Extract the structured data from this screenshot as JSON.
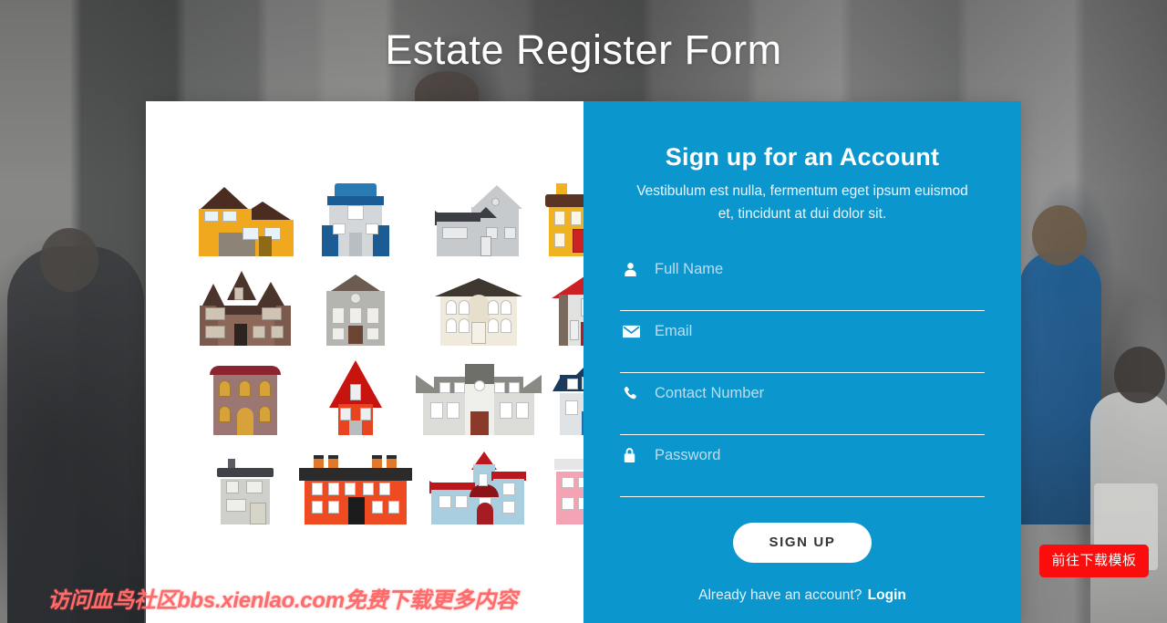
{
  "page": {
    "title": "Estate Register Form",
    "accent_blue": "#0b96ce",
    "card_bg": "#ffffff"
  },
  "illustration": {
    "alt": "grid of sixteen flat-style house illustrations",
    "rows": [
      [
        {
          "name": "yellow-victorian-house",
          "wall": "#f0a91e",
          "roof": "#4a2c20",
          "door": "#f0a91e"
        },
        {
          "name": "blue-roof-townhouse",
          "wall": "#d3d7da",
          "roof": "#1a5c93",
          "door": "#b9bec2"
        },
        {
          "name": "grey-gable-house",
          "wall": "#c7cacc",
          "roof": "#3b3f44",
          "door": "#e8eaec"
        },
        {
          "name": "yellow-shopfront-house",
          "wall": "#f0b21e",
          "roof": "#5a3526",
          "door": "#cc2222"
        }
      ],
      [
        {
          "name": "brown-manor-house",
          "wall": "#7b5a4d",
          "roof": "#4a342c",
          "door": "#2c2420"
        },
        {
          "name": "grey-gambrel-barn-house",
          "wall": "#b4b4b0",
          "roof": "#6b5b50",
          "door": "#6b4434"
        },
        {
          "name": "cream-colonial-house",
          "wall": "#efeadc",
          "roof": "#3e3830",
          "door": "#f4f1e8"
        },
        {
          "name": "red-roof-chalet",
          "wall": "#e2e2e0",
          "roof": "#cc1f26",
          "door": "#b31c22"
        }
      ],
      [
        {
          "name": "mauve-terrace-house",
          "wall": "#9b7672",
          "roof": "#8b2430",
          "door": "#d8a23a"
        },
        {
          "name": "red-a-frame-house",
          "wall": "#e8441f",
          "roof": "#c7140f",
          "door": "#b8bcbf"
        },
        {
          "name": "grey-mansion-house",
          "wall": "#dcdcd8",
          "roof": "#8a8a84",
          "door": "#8b3a2a"
        },
        {
          "name": "navy-roof-cottage",
          "wall": "#dfe3e6",
          "roof": "#1c3a5e",
          "door": "#2a6ea8"
        }
      ],
      [
        {
          "name": "grey-modern-house",
          "wall": "#cfd0cc",
          "roof": "#3f4347",
          "door": "#d7d4c8"
        },
        {
          "name": "red-brick-rowhouse",
          "wall": "#ee4b22",
          "roof": "#2b2b2b",
          "door": "#1c1c1c"
        },
        {
          "name": "blue-tower-villa",
          "wall": "#a9cee0",
          "roof": "#b8181e",
          "door": "#a51d22"
        },
        {
          "name": "pink-storefront-house",
          "wall": "#f4a3b4",
          "roof": "#e6e6e6",
          "door": "#f6d3da"
        }
      ]
    ]
  },
  "form": {
    "heading": "Sign up for an Account",
    "subtitle": "Vestibulum est nulla, fermentum eget ipsum euismod et, tincidunt at dui dolor sit.",
    "fields": [
      {
        "name": "full-name",
        "icon": "user-icon",
        "placeholder": "Full Name",
        "value": ""
      },
      {
        "name": "email",
        "icon": "envelope-icon",
        "placeholder": "Email",
        "value": ""
      },
      {
        "name": "contact-number",
        "icon": "phone-icon",
        "placeholder": "Contact Number",
        "value": ""
      },
      {
        "name": "password",
        "icon": "lock-icon",
        "placeholder": "Password",
        "value": ""
      }
    ],
    "submit_label": "SIGN UP",
    "login_prompt": "Already have an account?",
    "login_label": "Login"
  },
  "watermarks": {
    "bottom_text": "访问血鸟社区bbs.xienlao.com免费下载更多内容",
    "bottom_color": "#ff6b6b",
    "download_badge": "前往下载模板",
    "download_badge_color": "#fc0d0d"
  }
}
